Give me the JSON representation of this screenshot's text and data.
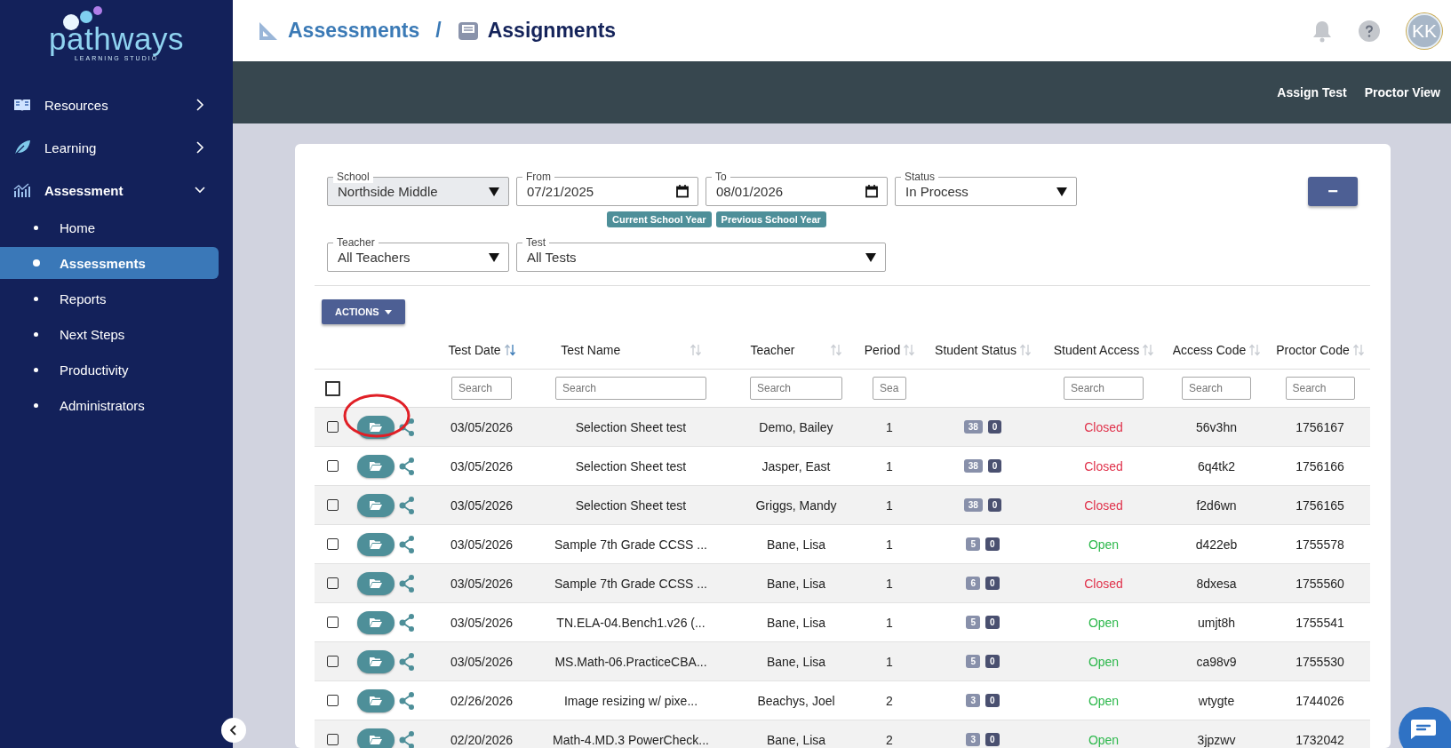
{
  "logo": {
    "name": "pathways",
    "tagline": "LEARNING STUDIO"
  },
  "sidebar": {
    "items": [
      {
        "label": "Resources",
        "expanded": false
      },
      {
        "label": "Learning",
        "expanded": false
      },
      {
        "label": "Assessment",
        "expanded": true,
        "children": [
          {
            "label": "Home",
            "selected": false
          },
          {
            "label": "Assessments",
            "selected": true
          },
          {
            "label": "Reports",
            "selected": false
          },
          {
            "label": "Next Steps",
            "selected": false
          },
          {
            "label": "Productivity",
            "selected": false
          },
          {
            "label": "Administrators",
            "selected": false
          }
        ]
      }
    ]
  },
  "breadcrumb": [
    "Assessments",
    "Assignments"
  ],
  "breadcrumb_separator": "/",
  "user": {
    "initials": "KK"
  },
  "toolbar": {
    "links": [
      "Assign Test",
      "Proctor View"
    ]
  },
  "filters": {
    "row_1": [
      {
        "label": "School",
        "value": "Northside Middle",
        "kind": "select",
        "disabled": true
      },
      {
        "label": "From",
        "value": "07/21/2025",
        "kind": "date",
        "disabled": false
      },
      {
        "label": "To",
        "value": "08/01/2026",
        "kind": "date",
        "disabled": false
      },
      {
        "label": "Status",
        "value": "In Process",
        "kind": "select",
        "disabled": false
      }
    ],
    "quick_ranges": [
      "Current School Year",
      "Previous School Year"
    ],
    "row_2": [
      {
        "label": "Teacher",
        "value": "All Teachers",
        "kind": "select",
        "disabled": false
      },
      {
        "label": "Test",
        "value": "All Tests",
        "kind": "select",
        "disabled": false
      }
    ]
  },
  "collapse_button": {
    "label": "−"
  },
  "actions_button": {
    "label": "ACTIONS"
  },
  "table": {
    "select_all": {
      "checked": false
    },
    "columns": [
      {
        "label": "Test Date",
        "sorted": true,
        "search_placeholder": "Search"
      },
      {
        "label": "Test Name",
        "sorted": false,
        "search_placeholder": "Search"
      },
      {
        "label": "Teacher",
        "sorted": false,
        "search_placeholder": "Search"
      },
      {
        "label": "Period",
        "sorted": false,
        "search_placeholder": "Sea"
      },
      {
        "label": "Student Status",
        "sorted": false
      },
      {
        "label": "Student Access",
        "sorted": false,
        "search_placeholder": "Search"
      },
      {
        "label": "Access Code",
        "sorted": false,
        "search_placeholder": "Search"
      },
      {
        "label": "Proctor Code",
        "sorted": false,
        "search_placeholder": "Search"
      }
    ],
    "rows": [
      {
        "checked": false,
        "circled": true,
        "date": "03/05/2026",
        "name": "Selection Sheet test",
        "teacher": "Demo, Bailey",
        "period": "1",
        "status_counts": [
          "38",
          "0"
        ],
        "access": "Closed",
        "access_open": false,
        "access_code": "56v3hn",
        "proctor_code": "1756167"
      },
      {
        "checked": false,
        "circled": false,
        "date": "03/05/2026",
        "name": "Selection Sheet test",
        "teacher": "Jasper, East",
        "period": "1",
        "status_counts": [
          "38",
          "0"
        ],
        "access": "Closed",
        "access_open": false,
        "access_code": "6q4tk2",
        "proctor_code": "1756166"
      },
      {
        "checked": false,
        "circled": false,
        "date": "03/05/2026",
        "name": "Selection Sheet test",
        "teacher": "Griggs, Mandy",
        "period": "1",
        "status_counts": [
          "38",
          "0"
        ],
        "access": "Closed",
        "access_open": false,
        "access_code": "f2d6wn",
        "proctor_code": "1756165"
      },
      {
        "checked": false,
        "circled": false,
        "date": "03/05/2026",
        "name": "Sample 7th Grade CCSS ...",
        "teacher": "Bane, Lisa",
        "period": "1",
        "status_counts": [
          "5",
          "0"
        ],
        "access": "Open",
        "access_open": true,
        "access_code": "d422eb",
        "proctor_code": "1755578"
      },
      {
        "checked": false,
        "circled": false,
        "date": "03/05/2026",
        "name": "Sample 7th Grade CCSS ...",
        "teacher": "Bane, Lisa",
        "period": "1",
        "status_counts": [
          "6",
          "0"
        ],
        "access": "Closed",
        "access_open": false,
        "access_code": "8dxesa",
        "proctor_code": "1755560"
      },
      {
        "checked": false,
        "circled": false,
        "date": "03/05/2026",
        "name": "TN.ELA-04.Bench1.v26 (...",
        "teacher": "Bane, Lisa",
        "period": "1",
        "status_counts": [
          "5",
          "0"
        ],
        "access": "Open",
        "access_open": true,
        "access_code": "umjt8h",
        "proctor_code": "1755541"
      },
      {
        "checked": false,
        "circled": false,
        "date": "03/05/2026",
        "name": "MS.Math-06.PracticeCBA...",
        "teacher": "Bane, Lisa",
        "period": "1",
        "status_counts": [
          "5",
          "0"
        ],
        "access": "Open",
        "access_open": true,
        "access_code": "ca98v9",
        "proctor_code": "1755530"
      },
      {
        "checked": false,
        "circled": false,
        "date": "02/26/2026",
        "name": "Image resizing w/ pixe...",
        "teacher": "Beachys, Joel",
        "period": "2",
        "status_counts": [
          "3",
          "0"
        ],
        "access": "Open",
        "access_open": true,
        "access_code": "wtygte",
        "proctor_code": "1744026"
      },
      {
        "checked": false,
        "circled": false,
        "date": "02/20/2026",
        "name": "Math-4.MD.3 PowerCheck...",
        "teacher": "Bane, Lisa",
        "period": "2",
        "status_counts": [
          "3",
          "0"
        ],
        "access": "Open",
        "access_open": true,
        "access_code": "3jpzwv",
        "proctor_code": "1732042"
      }
    ]
  }
}
